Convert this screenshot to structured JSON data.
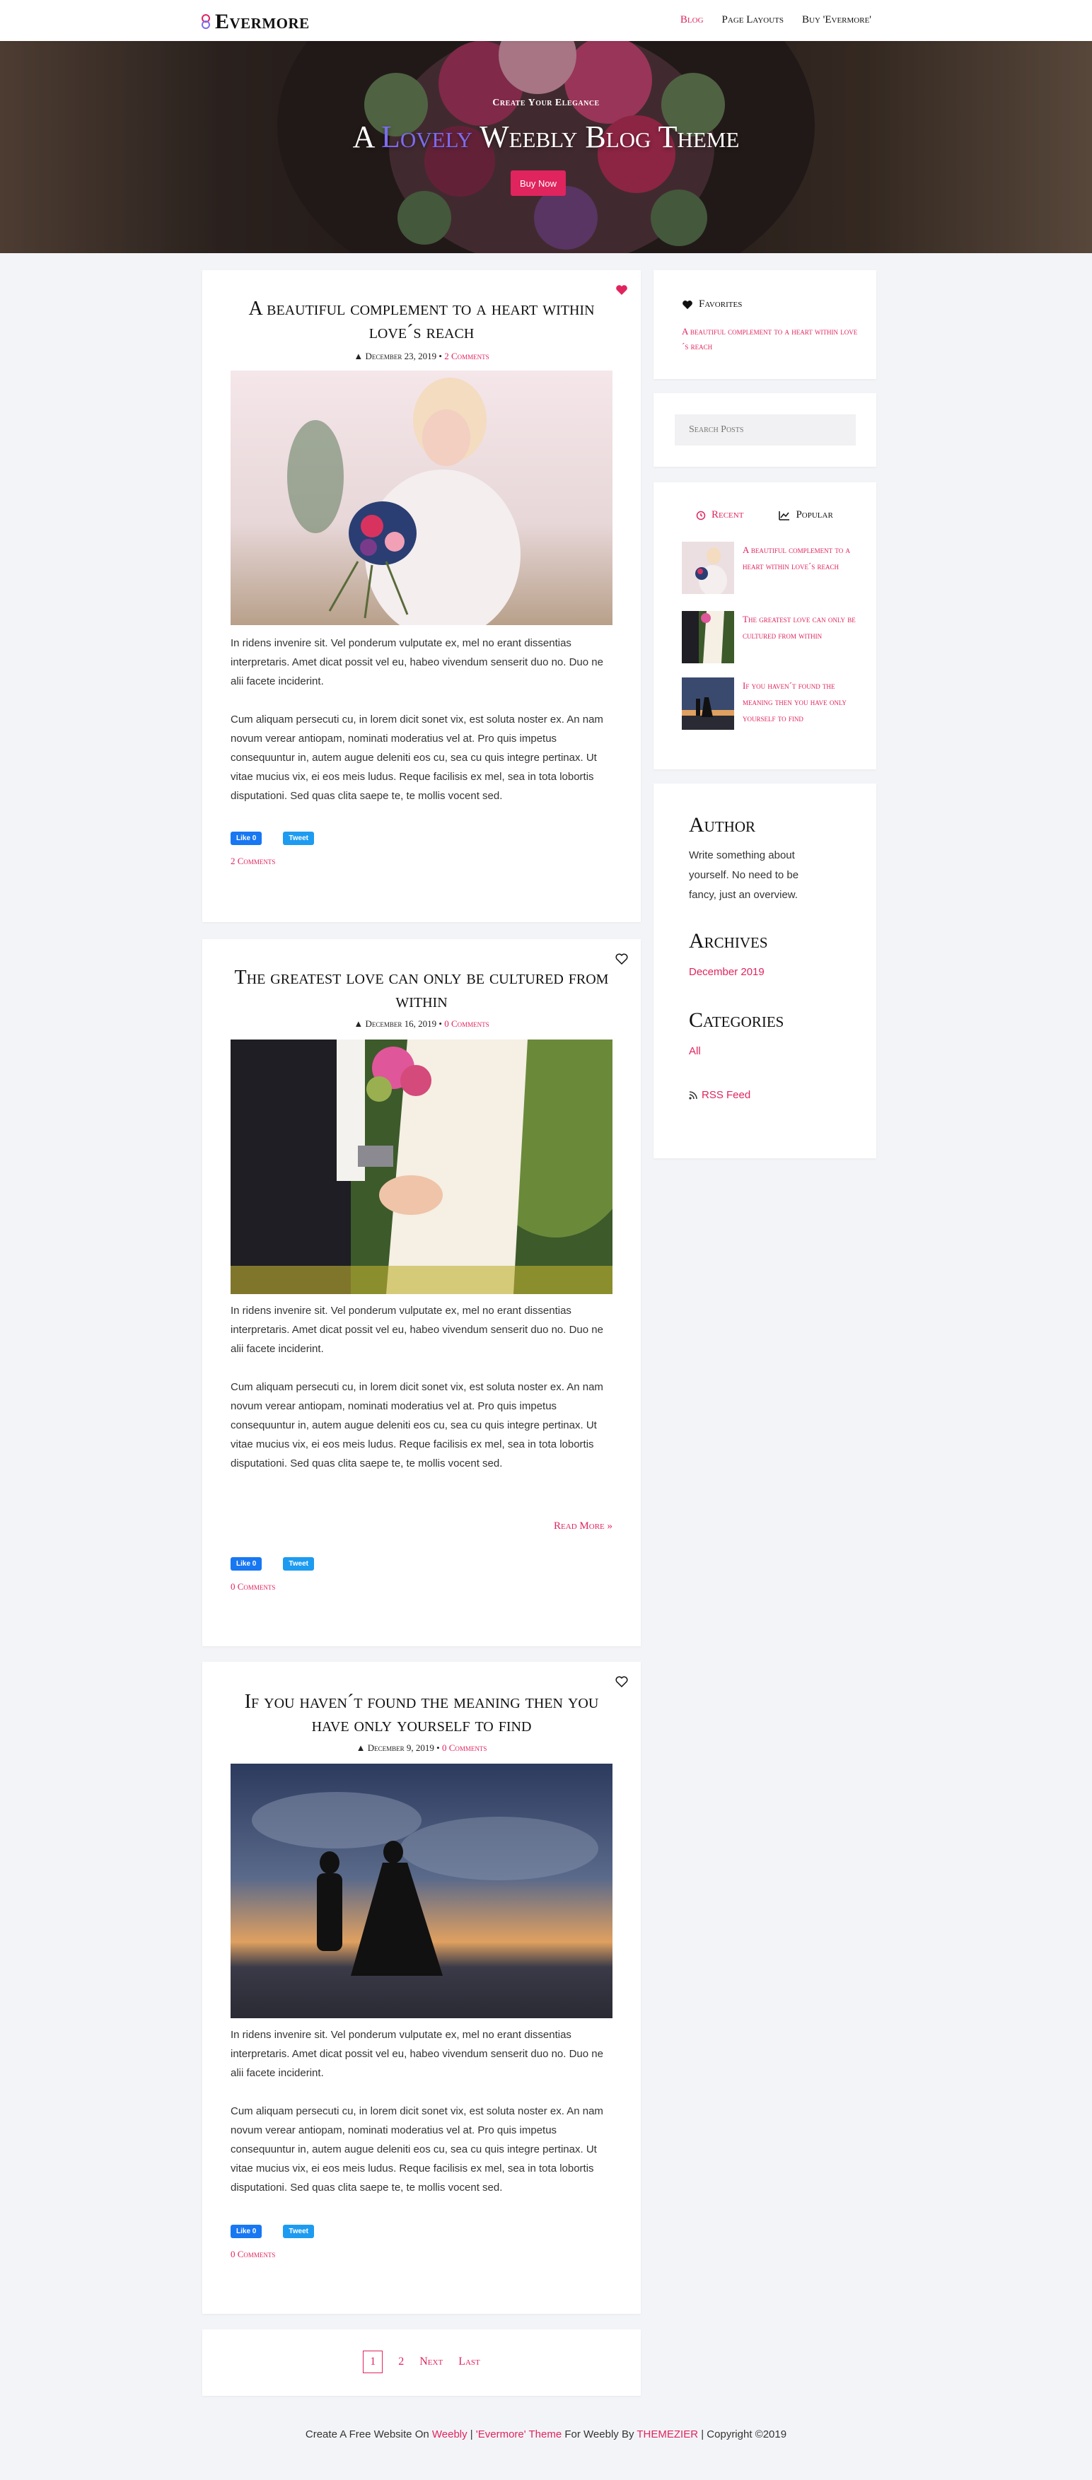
{
  "brand": {
    "name": "Evermore"
  },
  "nav": {
    "items": [
      "Blog",
      "Page Layouts",
      "Buy 'Evermore'"
    ]
  },
  "hero": {
    "subtitle": "Create Your Elegance",
    "title_prefix": "A",
    "title_highlight": "Lovely",
    "title_suffix": "Weebly Blog Theme",
    "button": "Buy Now"
  },
  "posts": [
    {
      "title": "A beautiful complement to a heart within love´s reach",
      "date": "December 23, 2019",
      "comments": "2 Comments",
      "para1": "In ridens invenire sit. Vel ponderum vulputate ex, mel no erant dissentias interpretaris. Amet dicat possit vel eu, habeo vivendum senserit duo no. Duo ne alii facete inciderint.",
      "para2": "Cum aliquam persecuti cu, in lorem dicit sonet vix, est soluta noster ex. An nam novum verear antiopam, nominati moderatius vel at. Pro quis impetus consequuntur in, autem augue deleniti eos cu, sea cu quis integre pertinax. Ut vitae mucius vix, ei eos meis ludus. Reque facilisis ex mel, sea in tota lobortis disputationi. Sed quas clita saepe te, te mollis vocent sed.",
      "like": "Like 0",
      "tweet": "Tweet"
    },
    {
      "title": "The greatest love can only be cultured from within",
      "date": "December 16, 2019",
      "comments": "0 Comments",
      "para1": "In ridens invenire sit. Vel ponderum vulputate ex, mel no erant dissentias interpretaris. Amet dicat possit vel eu, habeo vivendum senserit duo no. Duo ne alii facete inciderint.",
      "para2": "Cum aliquam persecuti cu, in lorem dicit sonet vix, est soluta noster ex. An nam novum verear antiopam, nominati moderatius vel at. Pro quis impetus consequuntur in, autem augue deleniti eos cu, sea cu quis integre pertinax. Ut vitae mucius vix, ei eos meis ludus. Reque facilisis ex mel, sea in tota lobortis disputationi. Sed quas clita saepe te, te mollis vocent sed.",
      "read_more": "Read More »",
      "like": "Like 0",
      "tweet": "Tweet"
    },
    {
      "title": "If you haven´t found the meaning then you have only yourself to find",
      "date": "December 9, 2019",
      "comments": "0 Comments",
      "para1": "In ridens invenire sit. Vel ponderum vulputate ex, mel no erant dissentias interpretaris. Amet dicat possit vel eu, habeo vivendum senserit duo no. Duo ne alii facete inciderint.",
      "para2": "Cum aliquam persecuti cu, in lorem dicit sonet vix, est soluta noster ex. An nam novum verear antiopam, nominati moderatius vel at. Pro quis impetus consequuntur in, autem augue deleniti eos cu, sea cu quis integre pertinax. Ut vitae mucius vix, ei eos meis ludus. Reque facilisis ex mel, sea in tota lobortis disputationi. Sed quas clita saepe te, te mollis vocent sed.",
      "like": "Like 0",
      "tweet": "Tweet"
    }
  ],
  "pagination": {
    "pages": [
      "1",
      "2"
    ],
    "next": "Next",
    "last": "Last"
  },
  "sidebar": {
    "favorites": {
      "heading": "Favorites",
      "link": "A beautiful complement to a heart within love´s reach"
    },
    "search": {
      "placeholder": "Search Posts"
    },
    "tabs": {
      "recent": "Recent",
      "popular": "Popular"
    },
    "recent": [
      "A beautiful complement to a heart within love´s reach",
      "The greatest love can only be cultured from within",
      "If you haven´t found the meaning then you have only yourself to find"
    ],
    "author": {
      "heading": "Author",
      "text": "Write something about yourself. No need to be fancy, just an overview."
    },
    "archives": {
      "heading": "Archives",
      "item": "December 2019"
    },
    "categories": {
      "heading": "Categories",
      "item": "All"
    },
    "rss": "RSS Feed"
  },
  "footer": {
    "t1": "Create A Free Website On",
    "weebly": "Weebly",
    "sep1": "|",
    "theme": "'Evermore' Theme",
    "t2": "For Weebly By",
    "themezier": "THEMEZIER",
    "sep2": "|",
    "copyright": "Copyright ©2019"
  },
  "colors": {
    "accent": "#e0245e",
    "background": "#f3f4f7"
  }
}
